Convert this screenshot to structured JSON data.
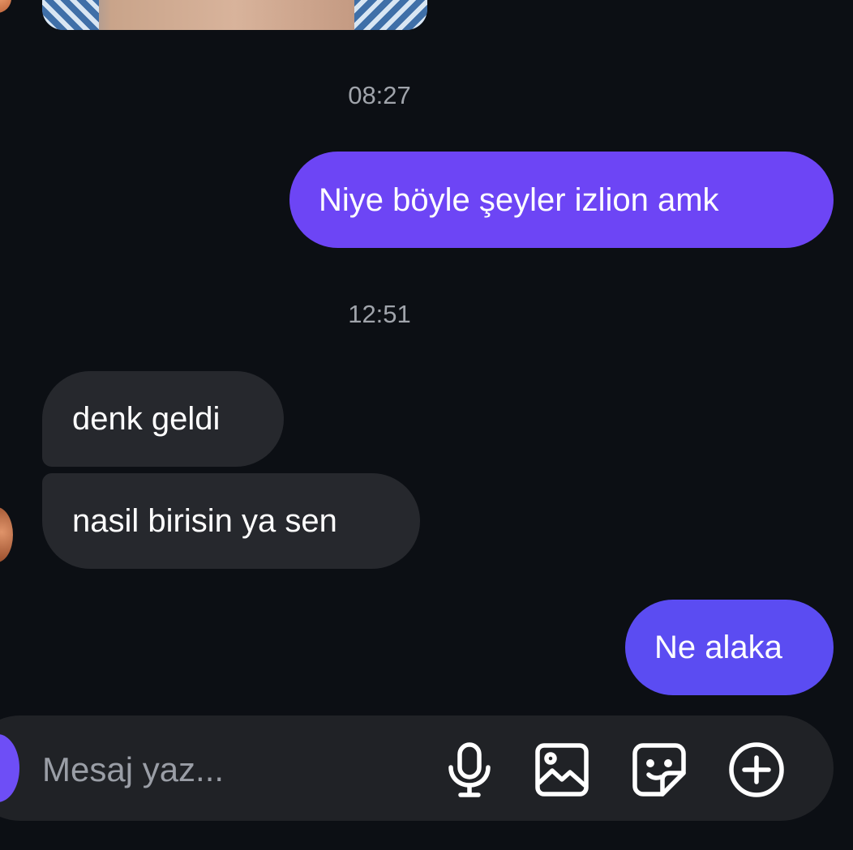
{
  "conversation": {
    "timestamps": [
      "08:27",
      "12:51"
    ],
    "messages": [
      {
        "direction": "outgoing",
        "text": "Niye böyle şeyler izlion amk"
      },
      {
        "direction": "incoming",
        "text": "denk geldi"
      },
      {
        "direction": "incoming",
        "text": "nasil birisin ya sen"
      },
      {
        "direction": "outgoing",
        "text": "Ne alaka"
      }
    ]
  },
  "composer": {
    "placeholder": "Mesaj yaz...",
    "icons": [
      "microphone-icon",
      "image-icon",
      "sticker-icon",
      "plus-circle-icon"
    ]
  },
  "colors": {
    "background": "#0c0f14",
    "outgoing_bubble": "#6d45f5",
    "incoming_bubble": "#26282d",
    "composer": "#202226",
    "timestamp": "#a0a4ab"
  }
}
